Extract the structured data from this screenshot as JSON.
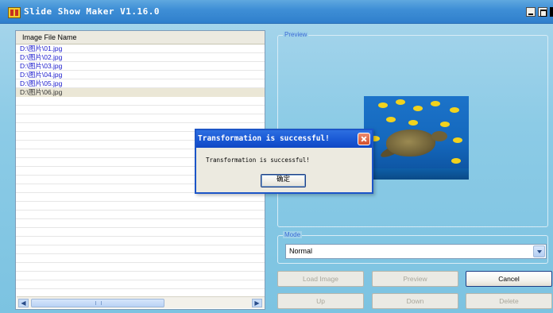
{
  "window": {
    "title": "Slide Show Maker V1.16.0"
  },
  "file_list": {
    "header": "Image File Name",
    "items": [
      "D:\\图片\\01.jpg",
      "D:\\图片\\02.jpg",
      "D:\\图片\\03.jpg",
      "D:\\图片\\04.jpg",
      "D:\\图片\\05.jpg",
      "D:\\图片\\06.jpg"
    ],
    "selected_index": 5
  },
  "preview": {
    "label": "Preview"
  },
  "mode": {
    "label": "Mode",
    "selected": "Normal"
  },
  "buttons": {
    "load_image": "Load Image",
    "preview": "Preview",
    "cancel": "Cancel",
    "up": "Up",
    "down": "Down",
    "delete": "Delete"
  },
  "dialog": {
    "title": "Transformation is successful!",
    "message": "Transformation is successful!",
    "ok": "确定"
  },
  "colors": {
    "titlebar": "#3f8fd6",
    "dialog_title": "#1b5ad6",
    "file_link": "#1a1acc",
    "group_label": "#3c6bd6"
  },
  "icons": {
    "app": "slideshow-app-icon",
    "close": "close-icon",
    "minimize": "minimize-icon",
    "maximize": "maximize-icon"
  }
}
